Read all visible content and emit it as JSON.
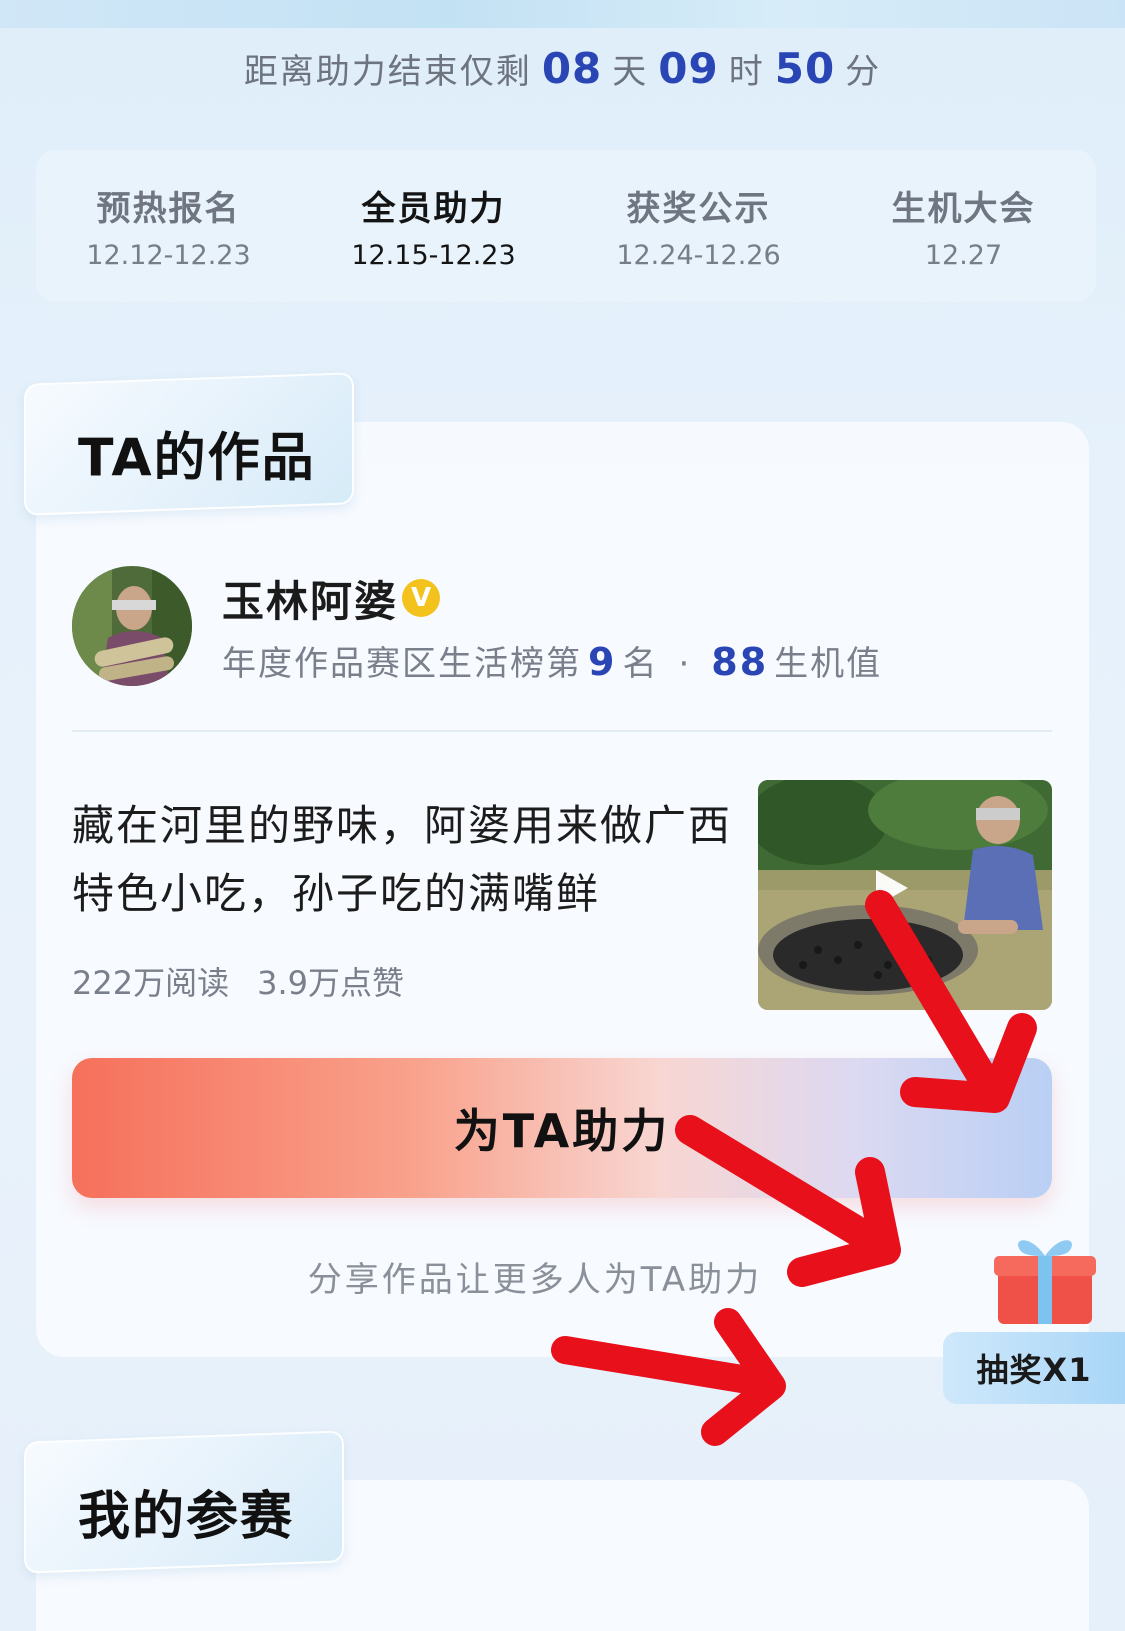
{
  "countdown": {
    "prefix": "距离助力结束仅剩",
    "days": "08",
    "days_unit": "天",
    "hours": "09",
    "hours_unit": "时",
    "minutes": "50",
    "minutes_unit": "分"
  },
  "timeline": {
    "stages": [
      {
        "name": "预热报名",
        "date": "12.12-12.23"
      },
      {
        "name": "全员助力",
        "date": "12.15-12.23"
      },
      {
        "name": "获奖公示",
        "date": "12.24-12.26"
      },
      {
        "name": "生机大会",
        "date": "12.27"
      }
    ],
    "active_index": 1
  },
  "works_section": {
    "title": "TA的作品",
    "author": {
      "name": "玉林阿婆",
      "verified_badge": "V",
      "rank_prefix": "年度作品赛区生活榜第",
      "rank": "9",
      "rank_suffix": "名",
      "separator": "·",
      "score": "88",
      "score_unit": "生机值"
    },
    "post": {
      "title": "藏在河里的野味，阿婆用来做广西特色小吃，孙子吃的满嘴鲜",
      "reads": "222万阅读",
      "likes": "3.9万点赞"
    },
    "support_button": "为TA助力",
    "share_hint": "分享作品让更多人为TA助力"
  },
  "lottery_badge": "抽奖X1",
  "my_entries_section": {
    "title": "我的参赛"
  },
  "colors": {
    "accent_blue": "#2a46b5",
    "button_start": "#f6705b",
    "button_end": "#b9cff4",
    "arrow_red": "#e8101a"
  },
  "icons": [
    "verified-icon",
    "play-icon",
    "gift-icon",
    "red-arrow-annotation"
  ]
}
